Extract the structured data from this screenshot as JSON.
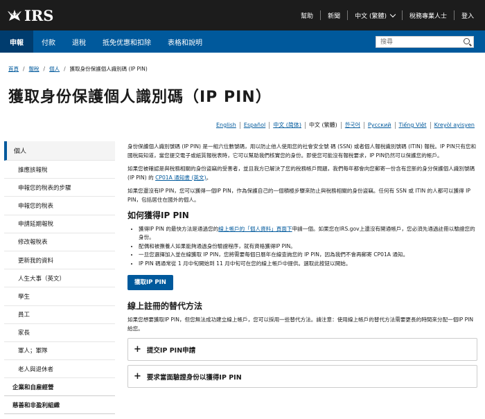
{
  "header": {
    "logo_text": "IRS",
    "links": [
      "幫助",
      "新聞",
      "中文 (繁體)",
      "稅務專業人士",
      "登入"
    ]
  },
  "nav": {
    "items": [
      "申報",
      "付款",
      "退稅",
      "抵免优惠和扣除",
      "表格和說明"
    ],
    "search_placeholder": "搜尋"
  },
  "breadcrumb": {
    "items": [
      "首頁",
      "報稅",
      "個人"
    ],
    "current": "獲取身份保護個人識別碼 (IP PIN)"
  },
  "page_title": "獲取身份保護個人識別碼（IP PIN）",
  "languages": [
    "English",
    "Español",
    "中文 (简体)",
    "中文 (繁體)",
    "한국어",
    "Русский",
    "Tiếng Việt",
    "Kreyòl ayisyen"
  ],
  "sidebar": {
    "active": "個人",
    "items": [
      "誰應該報稅",
      "申報您的稅表的步驟",
      "申報您的稅表",
      "申請延期報稅",
      "修改報稅表",
      "更新我的資料",
      "人生大事（英文）",
      "學生",
      "員工",
      "家長",
      "軍人；軍隊",
      "老人與退休者"
    ],
    "top_items": [
      "企業和自雇經營",
      "慈善和非盈利組織"
    ]
  },
  "content": {
    "p1": "身份保護個人識別號碼 (IP PIN) 是一組六位數號碼，用以防止他人使用您的社會安全號 碼 (SSN) 或者個人報稅識別號碼 (ITIN) 報稅。IP PIN只有您和國稅局知道，當您提交電子或紙質報稅表時，它可以幫助我們核實您的身份。即使您可能沒有報稅要求，IP PIN仍然可以保護您的帳戶。",
    "p2_before": "如果您被確認是與稅務相關的身份盜竊的受害者，並且我方已解決了您的稅務帳戶問題，我們每年都會向您郵寄一份含有您新的身分保護個人識別號碼 (IP PIN) 的 ",
    "p2_link": "CP01A 通知書 (英文)",
    "p2_after": "。",
    "p3": "如果您還沒有IP PIN，您可以獲得一個IP PIN，作為保護自己的一個積極步驟來防止與稅務相關的身份盜竊。任何有 SSN 或 ITIN 的人都可以獲得 IP PIN，包括居住在國外的個人。",
    "h_get": "如何獲得IP PIN",
    "b1_before": "獲得IP PIN 的最快方法是通過您的",
    "b1_link": "線上帳戶的「個人資料」頁面下",
    "b1_after": "申請一個。如果您在IRS.gov上還沒有開通帳戶，您必須先通過註冊以驗證您的身份。",
    "b2": "配偶和被撫養人如果能夠通過身份驗證程序，就有資格獲得IP PIN。",
    "b3": "一旦您選擇加入並在線獲取 IP PIN，您將需要每個日曆年在線查詢您的 IP PIN，因為我們不會再郵寄 CP01A 通知。",
    "b4": "IP PIN 碼通常從 1 月中旬開始到 11 月中旬可在您的線上帳戶中提供。選取此按鈕以開始。",
    "button": "獲取IP PIN",
    "h_alt": "線上註冊的替代方法",
    "p_alt": "如果您想要獲取IP PIN，但您無法成功建立線上帳戶，您可以採用一些替代方法。請注意：使用線上帳戶的替代方法需要更長的時間來分配一個IP PIN給您。",
    "acc1": "提交IP PIN申請",
    "acc2": "要求當面驗證身份以獲得IP PIN"
  }
}
